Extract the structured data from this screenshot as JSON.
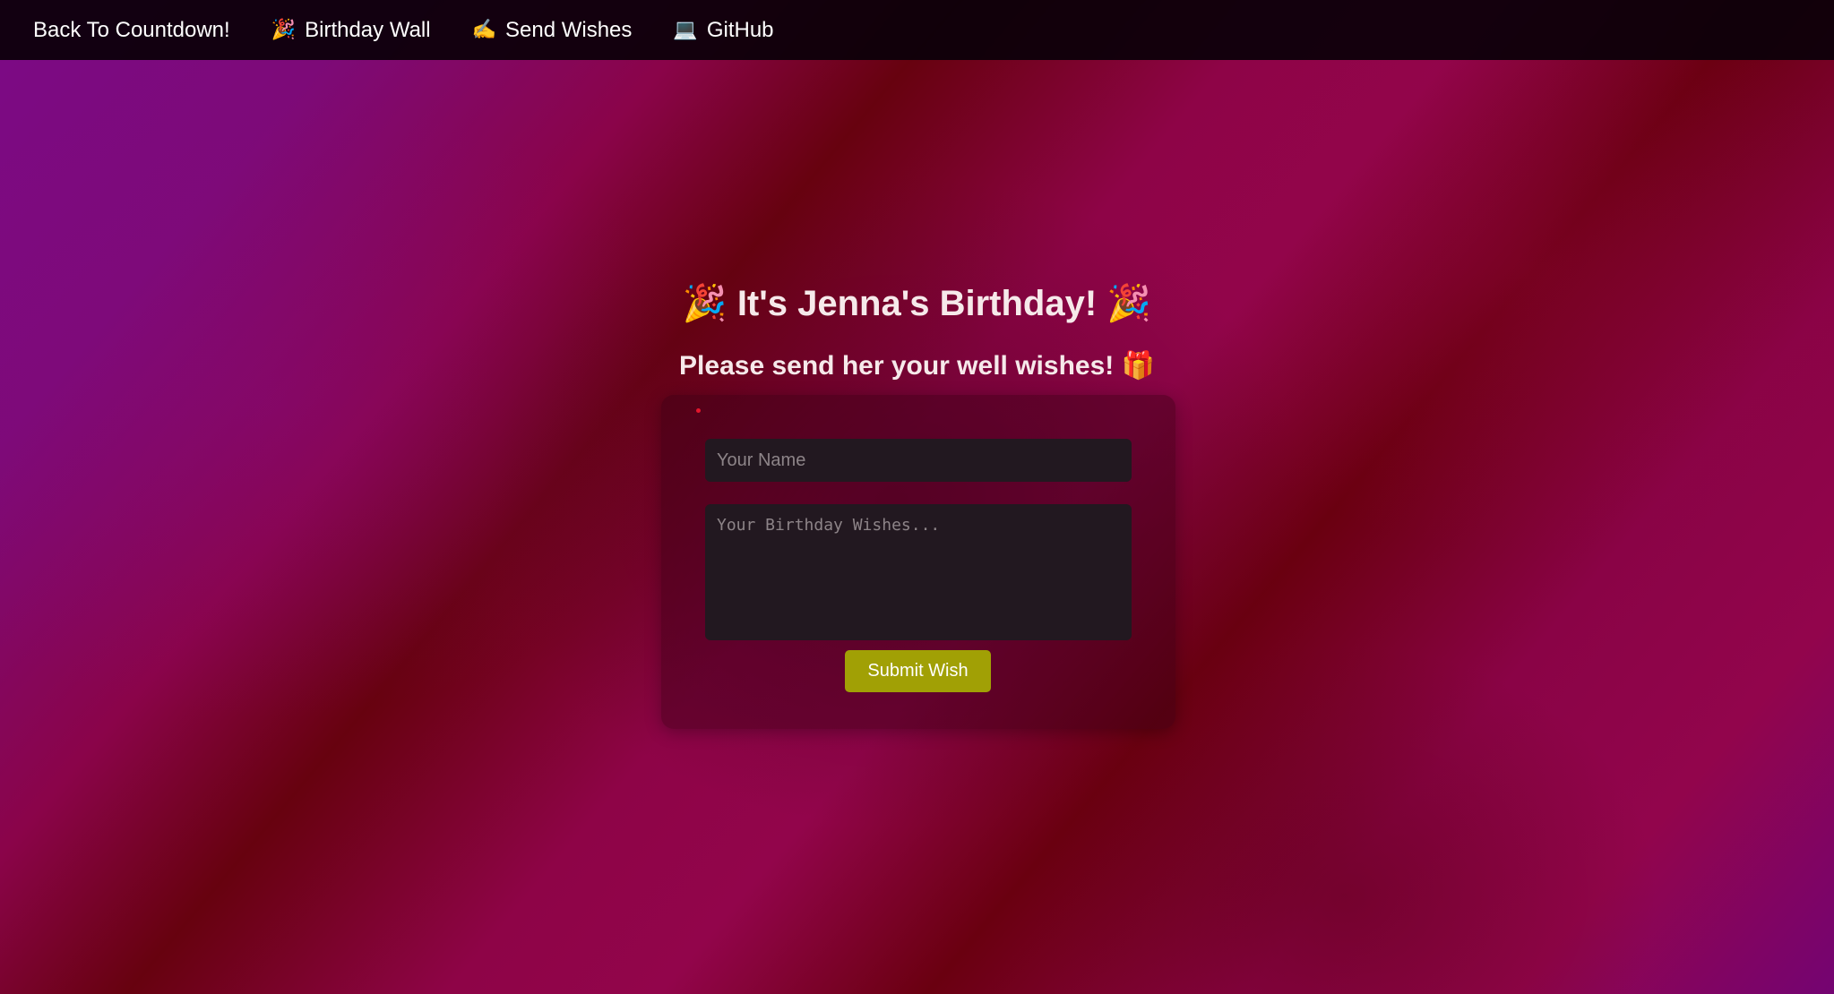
{
  "nav": {
    "items": [
      {
        "icon": "",
        "label": "Back To Countdown!"
      },
      {
        "icon": "🎉",
        "label": "Birthday Wall"
      },
      {
        "icon": "✍️",
        "label": "Send Wishes"
      },
      {
        "icon": "💻",
        "label": "GitHub"
      }
    ]
  },
  "header": {
    "emoji_left": "🎉",
    "title": "It's Jenna's Birthday!",
    "emoji_right": "🎉",
    "subtitle": "Please send her your well wishes!",
    "subtitle_emoji": "🎁"
  },
  "form": {
    "name_placeholder": "Your Name",
    "name_value": "",
    "wishes_placeholder": "Your Birthday Wishes...",
    "wishes_value": "",
    "submit_label": "Submit Wish"
  },
  "colors": {
    "navbar": "#0c000a",
    "button": "#a1a005",
    "input_bg": "#221820",
    "error_dot": "#e3162c"
  }
}
